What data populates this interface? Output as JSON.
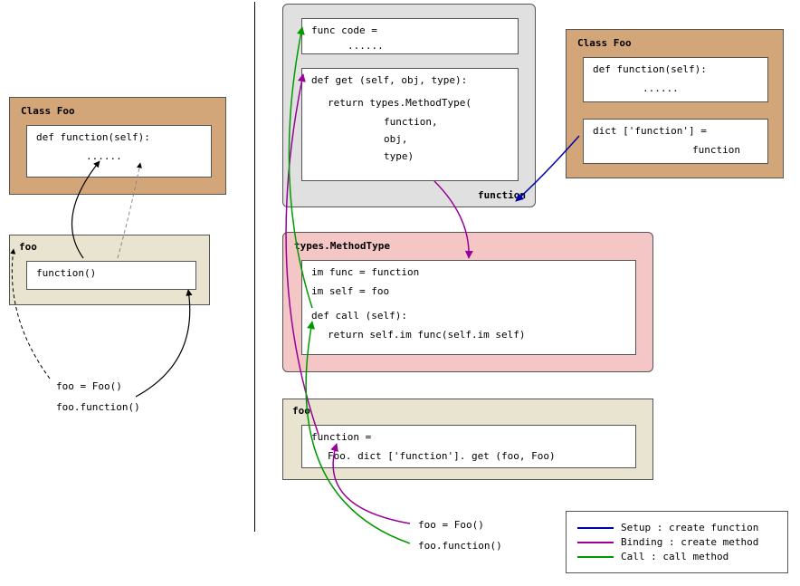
{
  "colors": {
    "classFooBg": "#d2a679",
    "fooBg": "#e8e4cf",
    "functionBg": "#e0e0e0",
    "methodTypeBg": "#f4c6c6",
    "setup": "#0000aa",
    "binding": "#990099",
    "call": "#009900"
  },
  "left": {
    "classFoo": {
      "title": "Class Foo",
      "code": "def function(self):",
      "dots": "......"
    },
    "foo": {
      "title": "foo",
      "code": "function()"
    },
    "callLines": {
      "l1": "foo = Foo()",
      "l2": "foo.function()"
    }
  },
  "right": {
    "function": {
      "funcCode": "func code =",
      "dots": "......",
      "getLine": "def  get  (self, obj, type):",
      "retLine": "return types.MethodType(",
      "arg1": "function,",
      "arg2": "obj,",
      "arg3": "type)",
      "label": "function"
    },
    "classFoo2": {
      "title": "Class Foo",
      "code": "def function(self):",
      "dots": "......",
      "dictLine": "dict  ['function'] =",
      "dictVal": "function"
    },
    "methodType": {
      "title": "types.MethodType",
      "l1": "im func = function",
      "l2": "im self = foo",
      "l3": "def  call  (self):",
      "l4": "return self.im func(self.im self)"
    },
    "foo2": {
      "title": "foo",
      "l1": "function =",
      "l2": "Foo.  dict  ['function'].  get  (foo, Foo)"
    },
    "callLines": {
      "l1": "foo = Foo()",
      "l2": "foo.function()"
    }
  },
  "legend": {
    "setup": "Setup : create function",
    "binding": "Binding : create method",
    "call": "Call : call method"
  }
}
